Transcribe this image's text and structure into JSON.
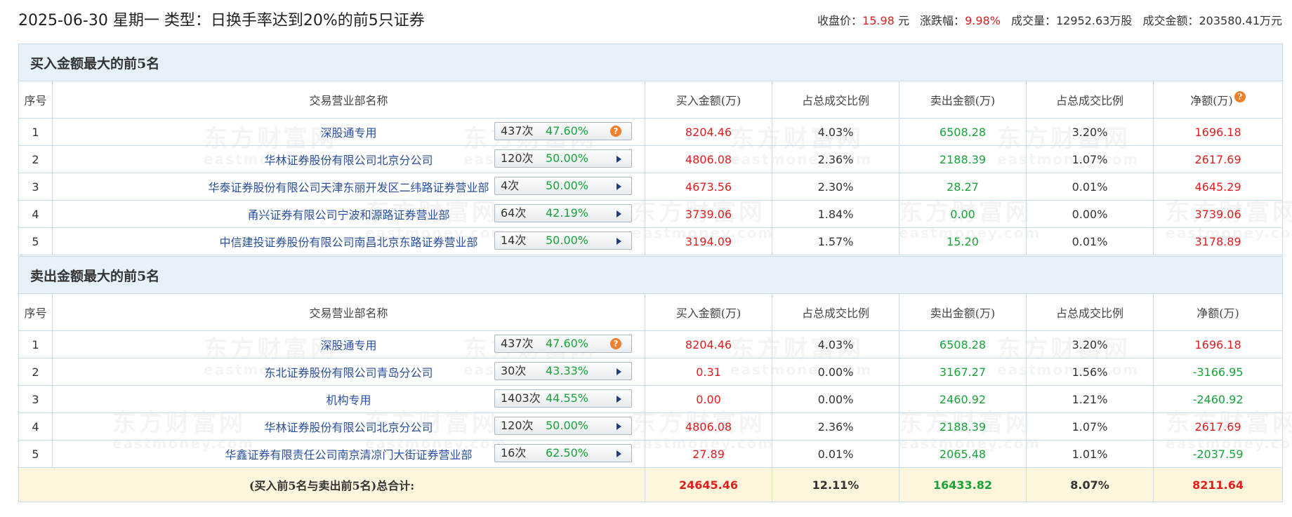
{
  "header": {
    "title": "2025-06-30 星期一 类型：日换手率达到20%的前5只证券",
    "close_label": "收盘价：",
    "close_value": "15.98",
    "close_unit": "元",
    "change_label": "涨跌幅：",
    "change_value": "9.98%",
    "volume_label": "成交量：",
    "volume_value": "12952.63万股",
    "amount_label": "成交金额：",
    "amount_value": "203580.41万元"
  },
  "columns": {
    "seq": "序号",
    "name": "交易营业部名称",
    "buy": "买入金额(万)",
    "buy_ratio": "占总成交比例",
    "sell": "卖出金额(万)",
    "sell_ratio": "占总成交比例",
    "net": "净额(万)"
  },
  "buy_section": {
    "title": "买入金额最大的前5名",
    "rows": [
      {
        "seq": "1",
        "name": "深股通专用",
        "count": "437次",
        "rate": "47.60%",
        "icon": "help",
        "buy": "8204.46",
        "buy_ratio": "4.03%",
        "sell": "6508.28",
        "sell_ratio": "3.20%",
        "net": "1696.18"
      },
      {
        "seq": "2",
        "name": "华林证券股份有限公司北京分公司",
        "count": "120次",
        "rate": "50.00%",
        "icon": "arrow",
        "buy": "4806.08",
        "buy_ratio": "2.36%",
        "sell": "2188.39",
        "sell_ratio": "1.07%",
        "net": "2617.69"
      },
      {
        "seq": "3",
        "name": "华泰证券股份有限公司天津东丽开发区二纬路证券营业部",
        "count": "4次",
        "rate": "50.00%",
        "icon": "arrow",
        "buy": "4673.56",
        "buy_ratio": "2.30%",
        "sell": "28.27",
        "sell_ratio": "0.01%",
        "net": "4645.29"
      },
      {
        "seq": "4",
        "name": "甬兴证券有限公司宁波和源路证券营业部",
        "count": "64次",
        "rate": "42.19%",
        "icon": "arrow",
        "buy": "3739.06",
        "buy_ratio": "1.84%",
        "sell": "0.00",
        "sell_ratio": "0.00%",
        "net": "3739.06"
      },
      {
        "seq": "5",
        "name": "中信建投证券股份有限公司南昌北京东路证券营业部",
        "count": "14次",
        "rate": "50.00%",
        "icon": "arrow",
        "buy": "3194.09",
        "buy_ratio": "1.57%",
        "sell": "15.20",
        "sell_ratio": "0.01%",
        "net": "3178.89"
      }
    ]
  },
  "sell_section": {
    "title": "卖出金额最大的前5名",
    "rows": [
      {
        "seq": "1",
        "name": "深股通专用",
        "count": "437次",
        "rate": "47.60%",
        "icon": "help",
        "buy": "8204.46",
        "buy_ratio": "4.03%",
        "sell": "6508.28",
        "sell_ratio": "3.20%",
        "net": "1696.18"
      },
      {
        "seq": "2",
        "name": "东北证券股份有限公司青岛分公司",
        "count": "30次",
        "rate": "43.33%",
        "icon": "arrow",
        "buy": "0.31",
        "buy_ratio": "0.00%",
        "sell": "3167.27",
        "sell_ratio": "1.56%",
        "net": "-3166.95"
      },
      {
        "seq": "3",
        "name": "机构专用",
        "count": "1403次",
        "rate": "44.55%",
        "icon": "arrow",
        "buy": "0.00",
        "buy_ratio": "0.00%",
        "sell": "2460.92",
        "sell_ratio": "1.21%",
        "net": "-2460.92"
      },
      {
        "seq": "4",
        "name": "华林证券股份有限公司北京分公司",
        "count": "120次",
        "rate": "50.00%",
        "icon": "arrow",
        "buy": "4806.08",
        "buy_ratio": "2.36%",
        "sell": "2188.39",
        "sell_ratio": "1.07%",
        "net": "2617.69"
      },
      {
        "seq": "5",
        "name": "华鑫证券有限责任公司南京清凉门大街证券营业部",
        "count": "16次",
        "rate": "62.50%",
        "icon": "arrow",
        "buy": "27.89",
        "buy_ratio": "0.01%",
        "sell": "2065.48",
        "sell_ratio": "1.01%",
        "net": "-2037.59"
      }
    ]
  },
  "total": {
    "label": "(买入前5名与卖出前5名)总合计:",
    "buy": "24645.46",
    "buy_ratio": "12.11%",
    "sell": "16433.82",
    "sell_ratio": "8.07%",
    "net": "8211.64"
  },
  "watermark": {
    "cn": "东方财富网",
    "en": "eastmoney.com"
  },
  "help_glyph": "?",
  "colors": {
    "up": "#e31d1d",
    "down": "#1aa23a",
    "link": "#2a4f9a",
    "header_bg": "#e6f1fa",
    "total_bg": "#fdf6dc"
  }
}
